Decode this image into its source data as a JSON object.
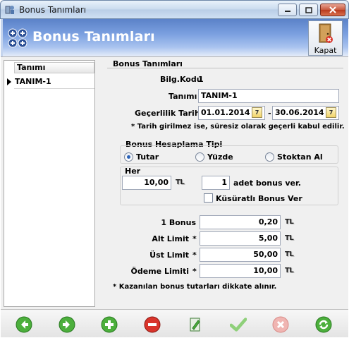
{
  "window": {
    "title": "Bonus Tanımları"
  },
  "header": {
    "title": "Bonus Tanımları",
    "close_label": "Kapat"
  },
  "grid": {
    "column": "Tanımı",
    "rows": [
      "TANIM-1"
    ]
  },
  "form": {
    "section_title": "Bonus Tanımları",
    "code_label": "Bilg.Kodu",
    "code_value": "1",
    "name_label": "Tanımı",
    "name_value": "TANIM-1",
    "date_label": "Geçerlilik Tarihi",
    "date_from": "01.01.2014",
    "date_sep": "-",
    "date_to": "30.06.2014",
    "date_note": "* Tarih girilmez ise, süresiz olarak geçerli kabul edilir.",
    "calc_type_label": "Bonus Hesaplama Tipi",
    "calc_options": [
      {
        "label": "Tutar",
        "selected": true
      },
      {
        "label": "Yüzde",
        "selected": false
      },
      {
        "label": "Stoktan Al",
        "selected": false
      }
    ],
    "per_label": "Her",
    "per_amount": "10,00",
    "currency": "TL",
    "bonus_count": "1",
    "bonus_count_label": "adet bonus ver.",
    "fraction_label": "Küsüratlı Bonus Ver",
    "fraction_checked": false,
    "one_bonus_label": "1 Bonus",
    "one_bonus_value": "0,20",
    "lower_limit_label": "Alt Limit",
    "lower_limit_value": "5,00",
    "upper_limit_label": "Üst Limit",
    "upper_limit_value": "50,00",
    "payment_limit_label": "Ödeme Limiti",
    "payment_limit_value": "10,00",
    "required_mark": "*",
    "footer_note": "* Kazanılan bonus tutarları dikkate alınır."
  },
  "colors": {
    "header_blue": "#5b82c8",
    "nav_green": "#4caf3c",
    "delete_red": "#d9342b"
  },
  "toolbar_icons": [
    "previous-icon",
    "next-icon",
    "add-icon",
    "delete-icon",
    "edit-icon",
    "save-icon",
    "cancel-icon",
    "refresh-icon"
  ]
}
